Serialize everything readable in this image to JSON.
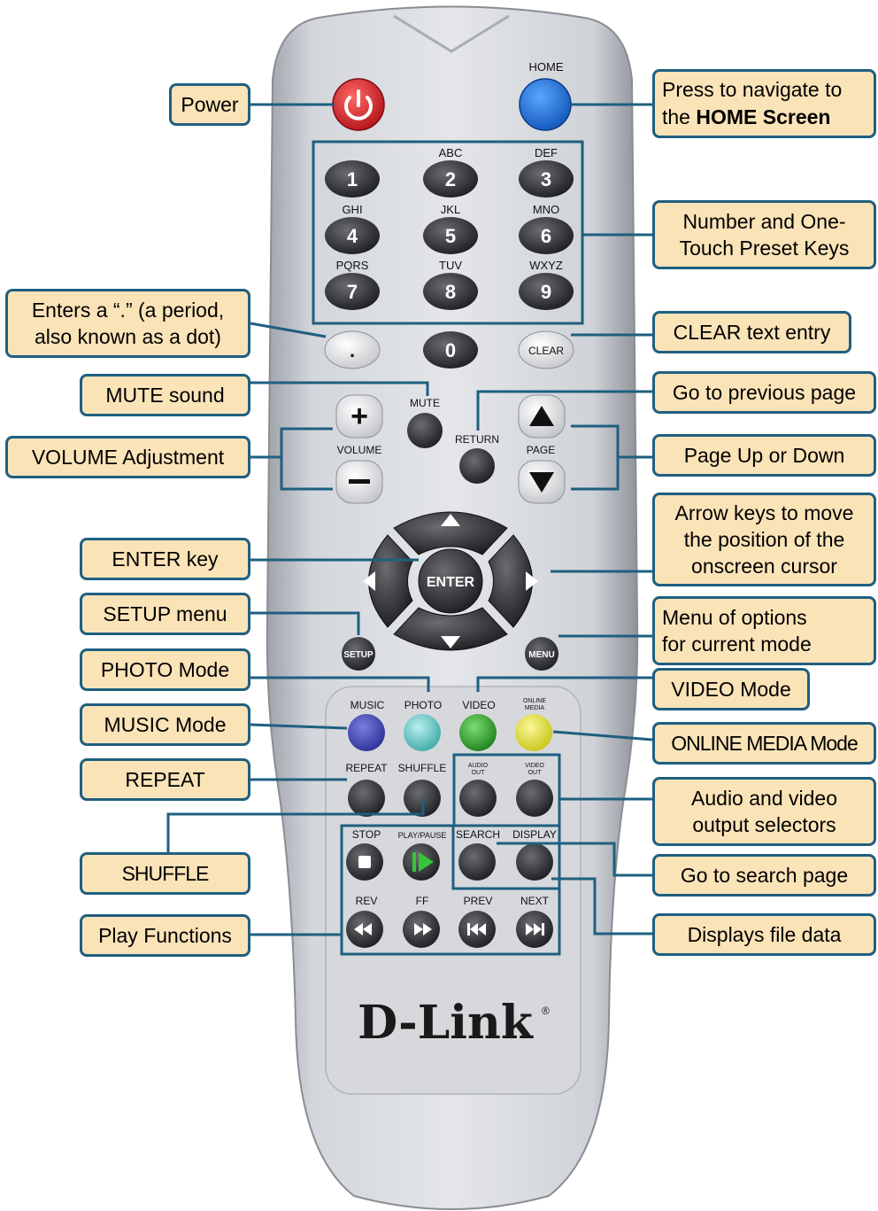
{
  "remote": {
    "top_labels": {
      "home": "HOME"
    },
    "number_keys": [
      {
        "key": "1",
        "letters": ""
      },
      {
        "key": "2",
        "letters": "ABC"
      },
      {
        "key": "3",
        "letters": "DEF"
      },
      {
        "key": "4",
        "letters": "GHI"
      },
      {
        "key": "5",
        "letters": "JKL"
      },
      {
        "key": "6",
        "letters": "MNO"
      },
      {
        "key": "7",
        "letters": "PQRS"
      },
      {
        "key": "8",
        "letters": "TUV"
      },
      {
        "key": "9",
        "letters": "WXYZ"
      }
    ],
    "dot_key": ".",
    "zero_key": "0",
    "clear_key": "CLEAR",
    "mute": "MUTE",
    "return": "RETURN",
    "volume": "VOLUME",
    "page": "PAGE",
    "enter": "ENTER",
    "setup": "SETUP",
    "menu": "MENU",
    "mode_labels": {
      "music": "MUSIC",
      "photo": "PHOTO",
      "video": "VIDEO",
      "online_line1": "ONLINE",
      "online_line2": "MEDIA"
    },
    "repeat": "REPEAT",
    "shuffle": "SHUFFLE",
    "audio_out_line1": "AUDIO",
    "audio_out_line2": "OUT",
    "video_out_line1": "VIDEO",
    "video_out_line2": "OUT",
    "stop": "STOP",
    "play_pause": "PLAY/PAUSE",
    "search": "SEARCH",
    "display": "DISPLAY",
    "rev": "REV",
    "ff": "FF",
    "prev": "PREV",
    "next": "NEXT",
    "brand": "D-Link",
    "registered": "®"
  },
  "callouts": {
    "power": "Power",
    "home_line1": "Press to navigate to",
    "home_line2_prefix": "the ",
    "home_line2_bold": "HOME Screen",
    "numbers_line1": "Number and One-",
    "numbers_line2": "Touch Preset Keys",
    "dot_line1": "Enters a “.” (a period,",
    "dot_line2": "also known as a dot)",
    "clear": "CLEAR text entry",
    "mute": "MUTE sound",
    "return": "Go to previous page",
    "volume": "VOLUME Adjustment",
    "page": "Page Up or Down",
    "arrows_line1": "Arrow keys to move",
    "arrows_line2": "the position of the",
    "arrows_line3": "onscreen cursor",
    "enter": "ENTER key",
    "setup": "SETUP menu",
    "menu_line1": "Menu of options",
    "menu_line2": "for current mode",
    "photo": "PHOTO Mode",
    "video": "VIDEO Mode",
    "music": "MUSIC Mode",
    "online": "ONLINE MEDIA Mode",
    "repeat": "REPEAT",
    "av_line1": "Audio and video",
    "av_line2": "output selectors",
    "shuffle": "SHUFFLE",
    "search": "Go to search page",
    "play": "Play Functions",
    "display": "Displays file data"
  },
  "colors": {
    "callout_fill": "#fbe3b8",
    "callout_border": "#1f5f80",
    "remote_body": "#c9ccd2",
    "power_button": "#d8242c",
    "home_button": "#1d6fd6",
    "music_button": "#3b3fb2",
    "photo_button": "#66cccc",
    "video_button": "#2fa12c",
    "online_button": "#e6e12a"
  }
}
